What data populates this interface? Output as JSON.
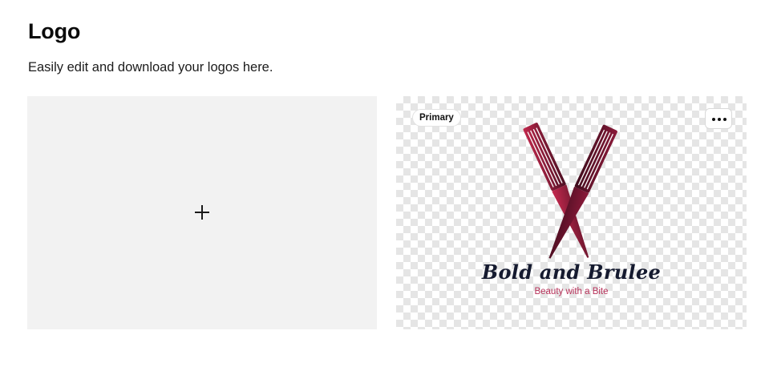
{
  "header": {
    "title": "Logo",
    "subtitle": "Easily edit and download your logos here."
  },
  "add_card": {
    "icon": "plus-icon"
  },
  "logo_card": {
    "badge": "Primary",
    "menu_icon": "more-horizontal-icon",
    "brand_name": "Bold and Brulee",
    "tagline": "Beauty with a Bite",
    "colors": {
      "comb_light": "#c4294e",
      "comb_dark": "#4a0f22",
      "brand_text": "#151a2f",
      "tagline_text": "#b8325a"
    }
  }
}
